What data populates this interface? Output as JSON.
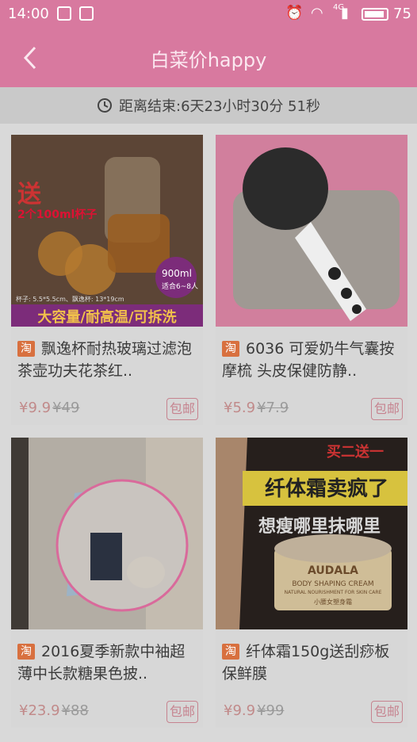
{
  "status": {
    "time": "14:00",
    "battery": "75",
    "network": "4G"
  },
  "header": {
    "title": "白菜价happy"
  },
  "timer": {
    "text": "距离结束:6天23小时30分 51秒"
  },
  "products": [
    {
      "name": "飘逸杯耐热玻璃过滤泡茶壶功夫花茶红..",
      "price": "¥9.9",
      "old_price": "¥49",
      "ship": "包邮",
      "badge": "淘",
      "img": {
        "promo": "送",
        "promo2": "2个100ml杯子",
        "volume": "900ml",
        "volume2": "适合6~8人",
        "banner": "大容量/耐高温/可拆洗",
        "note": "杯子: 5.5*5.5cm、飘逸杯: 13*19cm"
      }
    },
    {
      "name": "6036 可爱奶牛气囊按摩梳 头皮保健防静..",
      "price": "¥5.9",
      "old_price": "¥7.9",
      "ship": "包邮",
      "badge": "淘"
    },
    {
      "name": "2016夏季新款中袖超薄中长款糖果色披..",
      "price": "¥23.9",
      "old_price": "¥88",
      "ship": "包邮",
      "badge": "淘"
    },
    {
      "name": "纤体霜150g送刮痧板保鲜膜",
      "price": "¥9.9",
      "old_price": "¥99",
      "ship": "包邮",
      "badge": "淘",
      "img": {
        "promo": "买二送一",
        "headline": "纤体霜卖疯了",
        "tagline": "想瘦哪里抹哪里",
        "brand": "AUDALA",
        "sub": "BODY SHAPING CREAM",
        "sub2": "NATURAL NOURISHMENT FOR SKIN CARE",
        "sub3": "小腰女塑身霜"
      }
    }
  ],
  "colors": {
    "header": "#d8799f",
    "accent": "#c6838f"
  }
}
